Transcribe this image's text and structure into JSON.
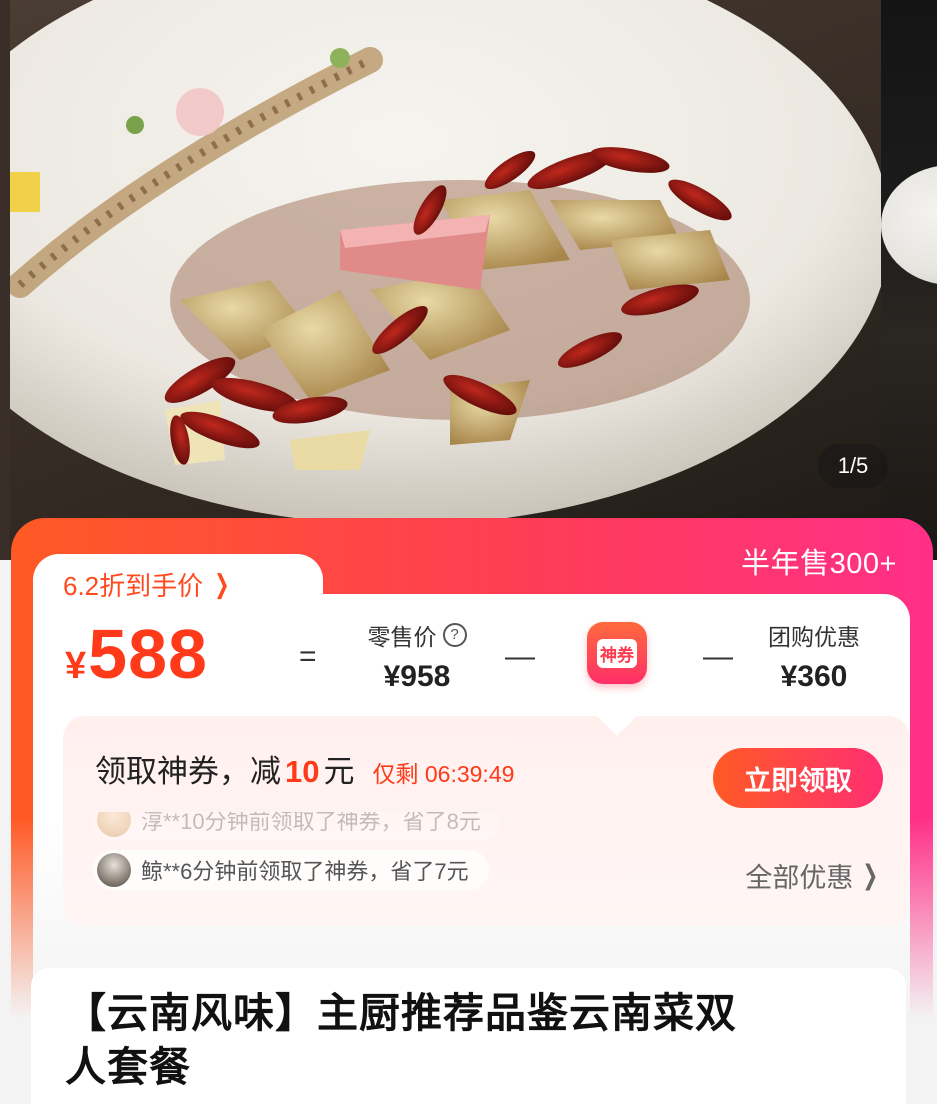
{
  "gallery": {
    "page_indicator": "1/5"
  },
  "sales": {
    "label": "半年售300+"
  },
  "pricing": {
    "discount_label": "6.2折到手价",
    "final_price_symbol": "¥",
    "final_price": "588",
    "equals": "=",
    "minus": "—",
    "retail_label": "零售价",
    "retail_value": "¥958",
    "coupon_badge": "神券",
    "group_label": "团购优惠",
    "group_value": "¥360"
  },
  "claim": {
    "text_prefix": "领取神券，减",
    "amount": "10",
    "unit": "元",
    "timer": "仅剩 06:39:49",
    "button": "立即领取",
    "activity_faded": "淳**10分钟前领取了神券，省了8元",
    "activity_main": "鲸**6分钟前领取了神券，省了7元",
    "all_offers": "全部优惠"
  },
  "product": {
    "title": "【云南风味】主厨推荐品鉴云南菜双人套餐"
  },
  "colors": {
    "accent": "#ff3a1a",
    "gradient_start": "#ff5a25",
    "gradient_end": "#ff2f88"
  }
}
